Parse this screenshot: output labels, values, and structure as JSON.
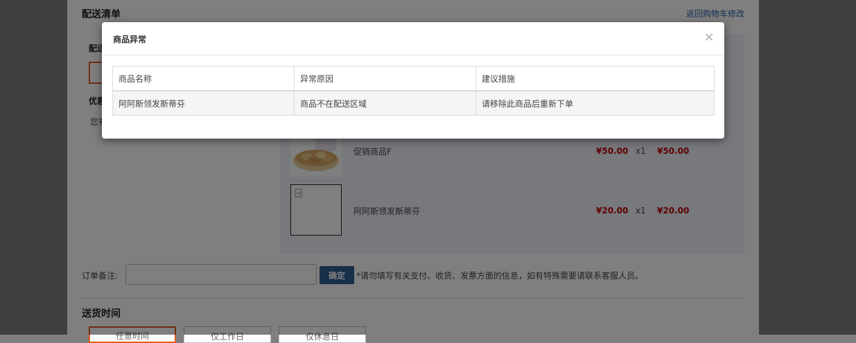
{
  "page": {
    "section_title": "配送清单",
    "back_link": "返回购物车修改",
    "left_label_1": "配送",
    "left_label_2": "优惠",
    "left_text": "您有",
    "items": [
      {
        "name": "促销商品F",
        "price": "¥50.00",
        "qty": "x1",
        "subtotal": "¥50.00"
      },
      {
        "name": "阿阿斯领发斯蒂芬",
        "price": "¥20.00",
        "qty": "x1",
        "subtotal": "¥20.00"
      }
    ],
    "remark": {
      "label": "订单备注:",
      "placeholder": "",
      "button": "确定",
      "hint": "*请勿填写有关支付、收货、发票方面的信息，如有特殊需要请联系客服人员。"
    },
    "delivery": {
      "title": "送货时间",
      "options": [
        "任意时间",
        "仅工作日",
        "仅休息日"
      ]
    }
  },
  "modal": {
    "title": "商品异常",
    "close_glyph": "×",
    "headers": [
      "商品名称",
      "异常原因",
      "建议措施"
    ],
    "rows": [
      [
        "阿阿斯领发斯蒂芬",
        "商品不在配送区域",
        "请移除此商品后重新下单"
      ]
    ]
  }
}
